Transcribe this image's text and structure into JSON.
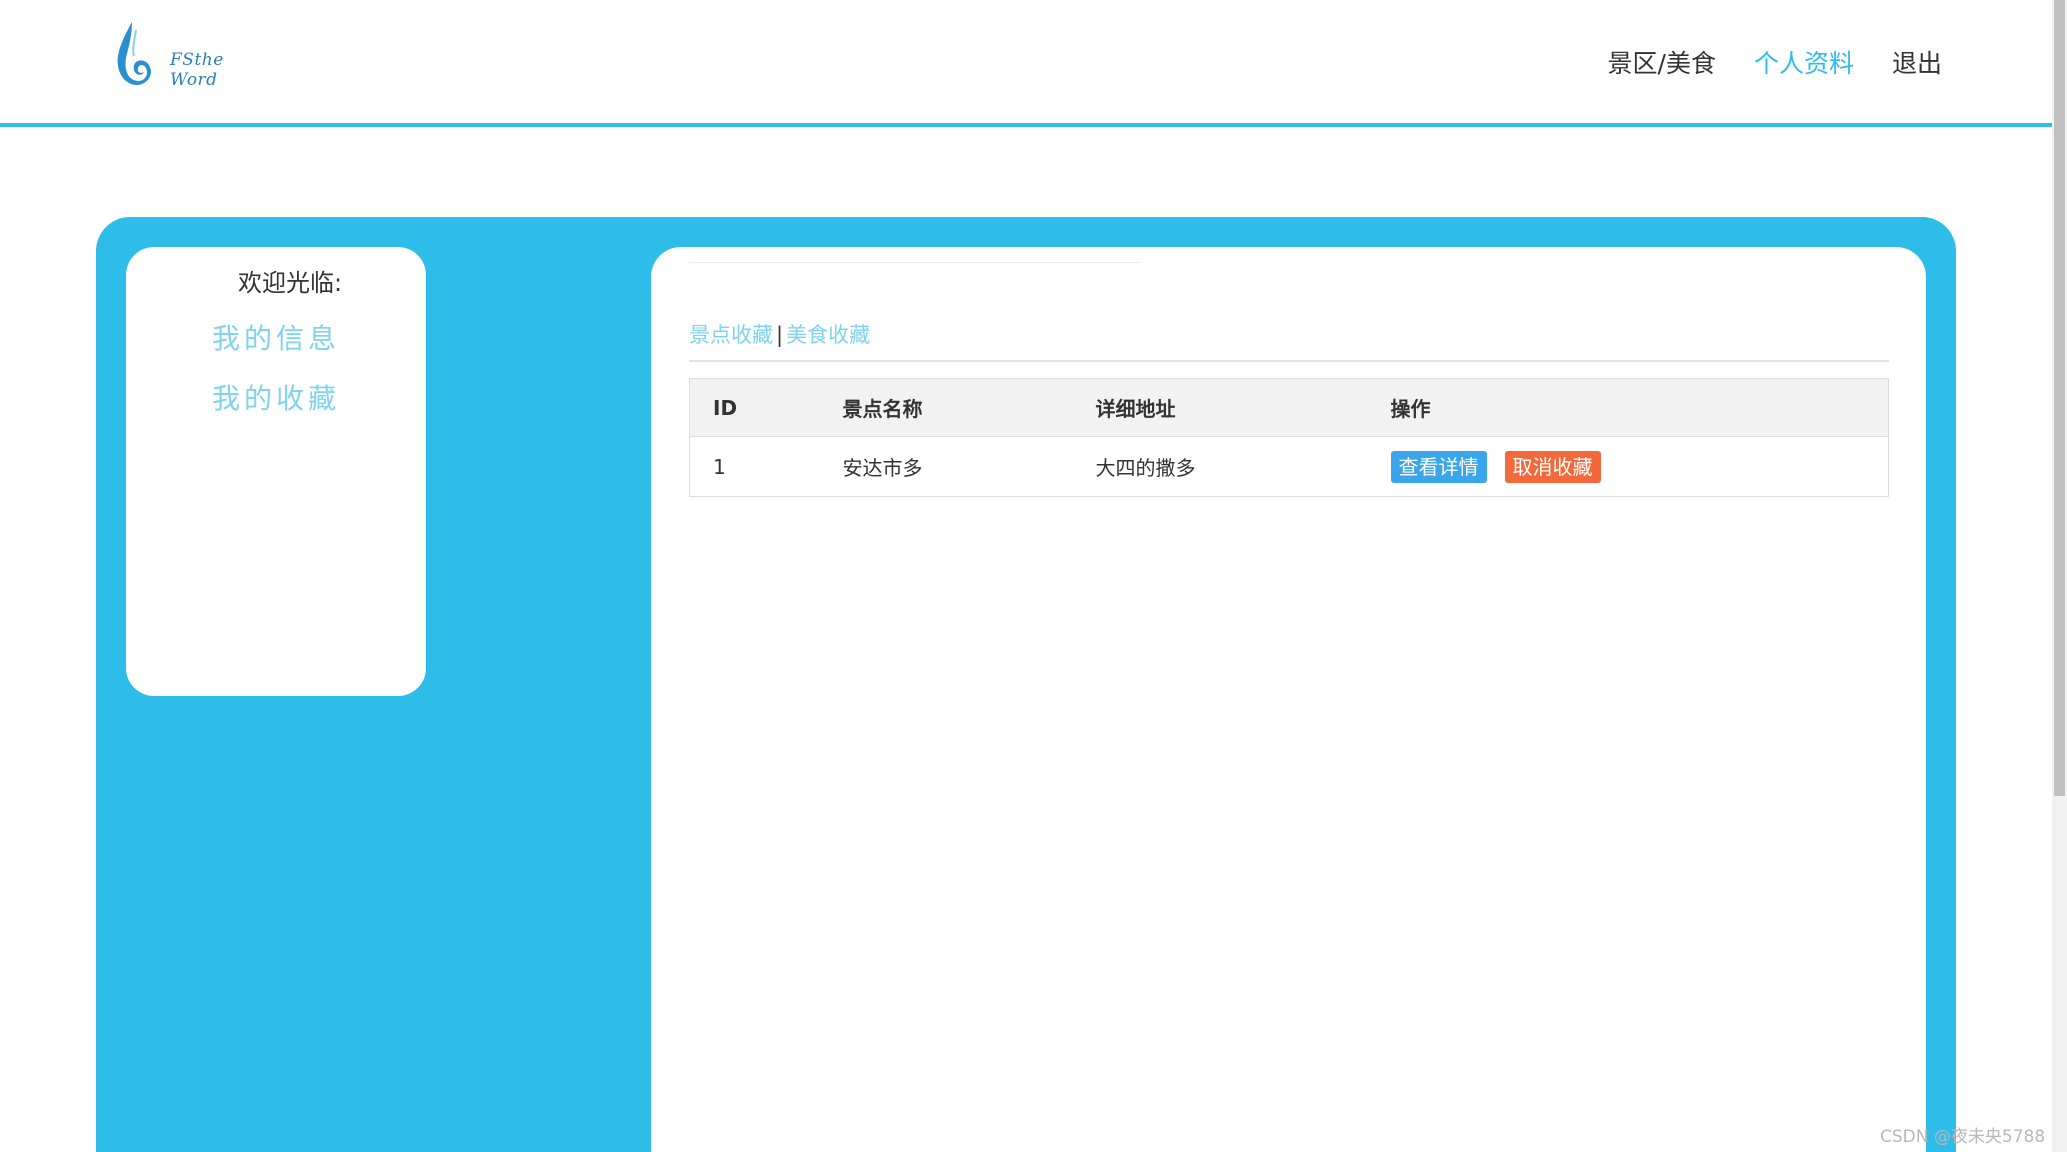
{
  "header": {
    "logo_text": "FSthe Word",
    "nav": [
      {
        "label": "景区/美食"
      },
      {
        "label": "个人资料"
      },
      {
        "label": "退出"
      }
    ]
  },
  "sidebar": {
    "welcome": "欢迎光临:",
    "links": [
      {
        "label": "我的信息"
      },
      {
        "label": "我的收藏"
      }
    ]
  },
  "main": {
    "tabs": [
      {
        "label": "景点收藏"
      },
      {
        "label": "美食收藏"
      }
    ],
    "tab_separator": "|",
    "table": {
      "headers": [
        "ID",
        "景点名称",
        "详细地址",
        "操作"
      ],
      "rows": [
        {
          "id": "1",
          "name": "安达市多",
          "address": "大四的撒多",
          "actions": [
            "查看详情",
            "取消收藏"
          ]
        }
      ]
    }
  },
  "watermark": "CSDN @夜未央5788",
  "colors": {
    "accent": "#2ebde9",
    "link_light": "#7fd3ee",
    "detail_button": "#3aa5ea",
    "cancel_button": "#f26a3c"
  },
  "icons": {
    "logo": "water-drop-logo-icon"
  }
}
